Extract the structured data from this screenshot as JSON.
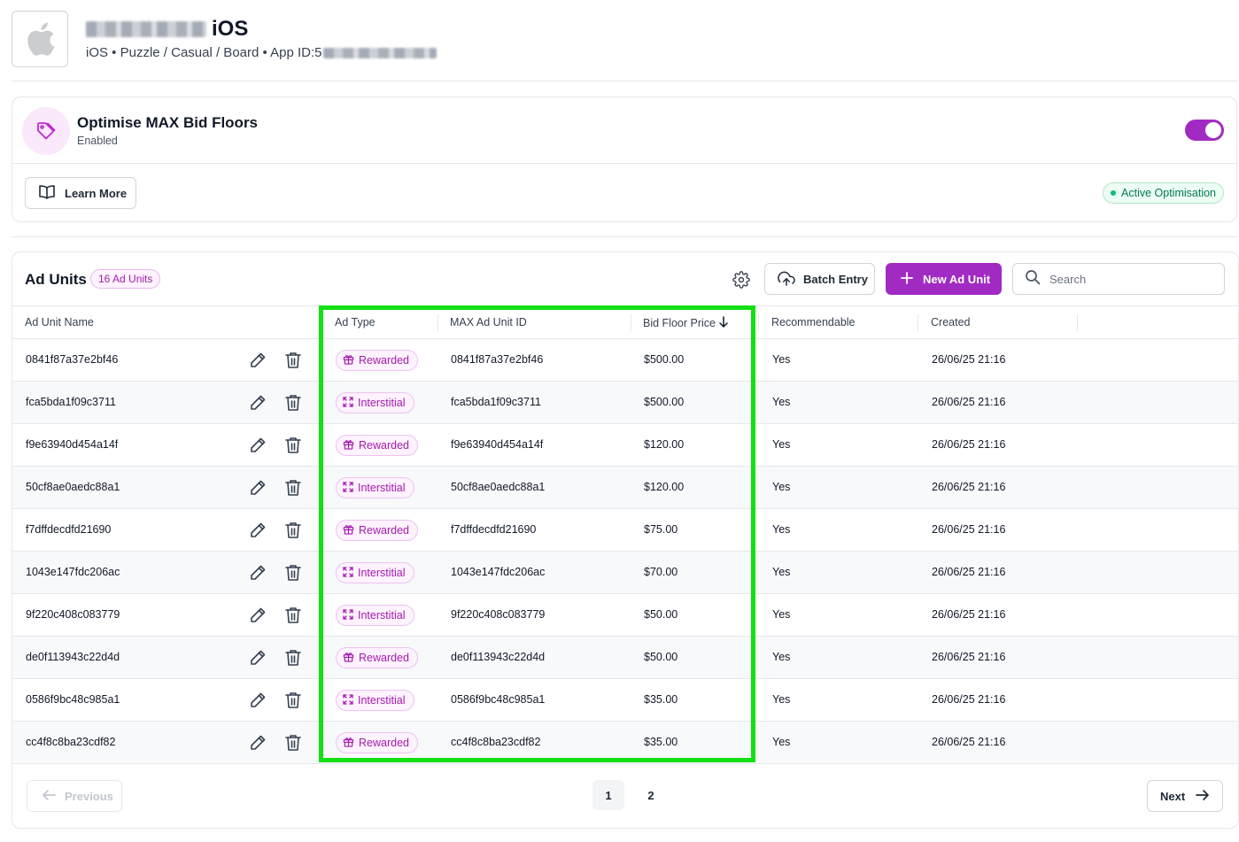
{
  "app": {
    "title_suffix": "iOS",
    "meta": "iOS • Puzzle / Casual / Board • App ID: ",
    "meta_id_prefix": "5"
  },
  "optimise": {
    "title": "Optimise MAX Bid Floors",
    "status": "Enabled",
    "toggle_on": true,
    "learn_more": "Learn More",
    "active_badge": "Active Optimisation"
  },
  "panel": {
    "title": "Ad Units",
    "count": "16 Ad Units",
    "batch_entry": "Batch Entry",
    "new_ad_unit": "New Ad Unit",
    "search_placeholder": "Search"
  },
  "table": {
    "headers": {
      "name": "Ad Unit Name",
      "type": "Ad Type",
      "max_id": "MAX Ad Unit ID",
      "bid_floor": "Bid Floor Price",
      "recommendable": "Recommendable",
      "created": "Created"
    },
    "rows": [
      {
        "name": "0841f87a37e2bf46",
        "type": "Rewarded",
        "max_id": "0841f87a37e2bf46",
        "bid_floor": "$500.00",
        "recommendable": "Yes",
        "created": "26/06/25 21:16"
      },
      {
        "name": "fca5bda1f09c3711",
        "type": "Interstitial",
        "max_id": "fca5bda1f09c3711",
        "bid_floor": "$500.00",
        "recommendable": "Yes",
        "created": "26/06/25 21:16"
      },
      {
        "name": "f9e63940d454a14f",
        "type": "Rewarded",
        "max_id": "f9e63940d454a14f",
        "bid_floor": "$120.00",
        "recommendable": "Yes",
        "created": "26/06/25 21:16"
      },
      {
        "name": "50cf8ae0aedc88a1",
        "type": "Interstitial",
        "max_id": "50cf8ae0aedc88a1",
        "bid_floor": "$120.00",
        "recommendable": "Yes",
        "created": "26/06/25 21:16"
      },
      {
        "name": "f7dffdecdfd21690",
        "type": "Rewarded",
        "max_id": "f7dffdecdfd21690",
        "bid_floor": "$75.00",
        "recommendable": "Yes",
        "created": "26/06/25 21:16"
      },
      {
        "name": "1043e147fdc206ac",
        "type": "Interstitial",
        "max_id": "1043e147fdc206ac",
        "bid_floor": "$70.00",
        "recommendable": "Yes",
        "created": "26/06/25 21:16"
      },
      {
        "name": "9f220c408c083779",
        "type": "Interstitial",
        "max_id": "9f220c408c083779",
        "bid_floor": "$50.00",
        "recommendable": "Yes",
        "created": "26/06/25 21:16"
      },
      {
        "name": "de0f113943c22d4d",
        "type": "Rewarded",
        "max_id": "de0f113943c22d4d",
        "bid_floor": "$50.00",
        "recommendable": "Yes",
        "created": "26/06/25 21:16"
      },
      {
        "name": "0586f9bc48c985a1",
        "type": "Interstitial",
        "max_id": "0586f9bc48c985a1",
        "bid_floor": "$35.00",
        "recommendable": "Yes",
        "created": "26/06/25 21:16"
      },
      {
        "name": "cc4f8c8ba23cdf82",
        "type": "Rewarded",
        "max_id": "cc4f8c8ba23cdf82",
        "bid_floor": "$35.00",
        "recommendable": "Yes",
        "created": "26/06/25 21:16"
      }
    ]
  },
  "pagination": {
    "previous": "Previous",
    "next": "Next",
    "pages": [
      "1",
      "2"
    ],
    "current": "1"
  },
  "icons": {
    "app": "apple-logo-icon",
    "optimise": "tag-icon",
    "learn_more": "book-open-icon",
    "settings": "gear-icon",
    "batch": "cloud-upload-icon",
    "new": "plus-icon",
    "search": "search-icon",
    "sort": "arrow-down-icon",
    "edit": "pencil-icon",
    "delete": "trash-icon",
    "rewarded": "gift-icon",
    "interstitial": "expand-icon",
    "previous": "arrow-left-icon",
    "next": "arrow-right-icon"
  },
  "colors": {
    "brand": "#a12bc2",
    "highlight": "#12e012",
    "success": "#047857"
  }
}
